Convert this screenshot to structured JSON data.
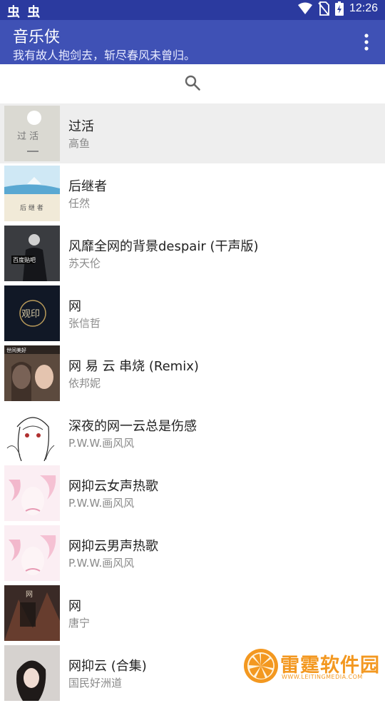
{
  "status_bar": {
    "left_glyphs": "虫 虫",
    "time": "12:26",
    "icons": [
      "wifi-icon",
      "no-sim-icon",
      "battery-charging-icon"
    ]
  },
  "app_bar": {
    "title": "音乐侠",
    "subtitle": "我有故人抱剑去，斩尽春风未曾归。",
    "menu_icon": "more-vert-icon"
  },
  "search": {
    "icon": "search-icon"
  },
  "songs": [
    {
      "title": "过活",
      "artist": "高鱼",
      "selected": true,
      "cover_text": "过 活"
    },
    {
      "title": "后继者",
      "artist": "任然",
      "cover_text": "后 继 者"
    },
    {
      "title": "风靡全网的背景despair (干声版)",
      "artist": "苏天伦",
      "cover_text": "百度贴吧"
    },
    {
      "title": "网",
      "artist": "张信哲",
      "cover_text": "观印"
    },
    {
      "title": "网 易 云 串烧 (Remix)",
      "artist": "依邦妮",
      "cover_text": "世间美好"
    },
    {
      "title": "深夜的网一云总是伤感",
      "artist": "P.W.W.画风风"
    },
    {
      "title": "网抑云女声热歌",
      "artist": "P.W.W.画风风"
    },
    {
      "title": "网抑云男声热歌",
      "artist": "P.W.W.画风风"
    },
    {
      "title": "网",
      "artist": "唐宁",
      "cover_text": "网"
    },
    {
      "title": "网抑云 (合集)",
      "artist": "国民好洲道"
    }
  ],
  "watermark": {
    "name": "雷霆软件园",
    "url": "WWW.LEITINGMEDIA.COM"
  },
  "colors": {
    "status_bar": "#2b3a9f",
    "app_bar": "#3f51b5",
    "selected_row": "#eeeeee",
    "watermark": "#f39820"
  }
}
